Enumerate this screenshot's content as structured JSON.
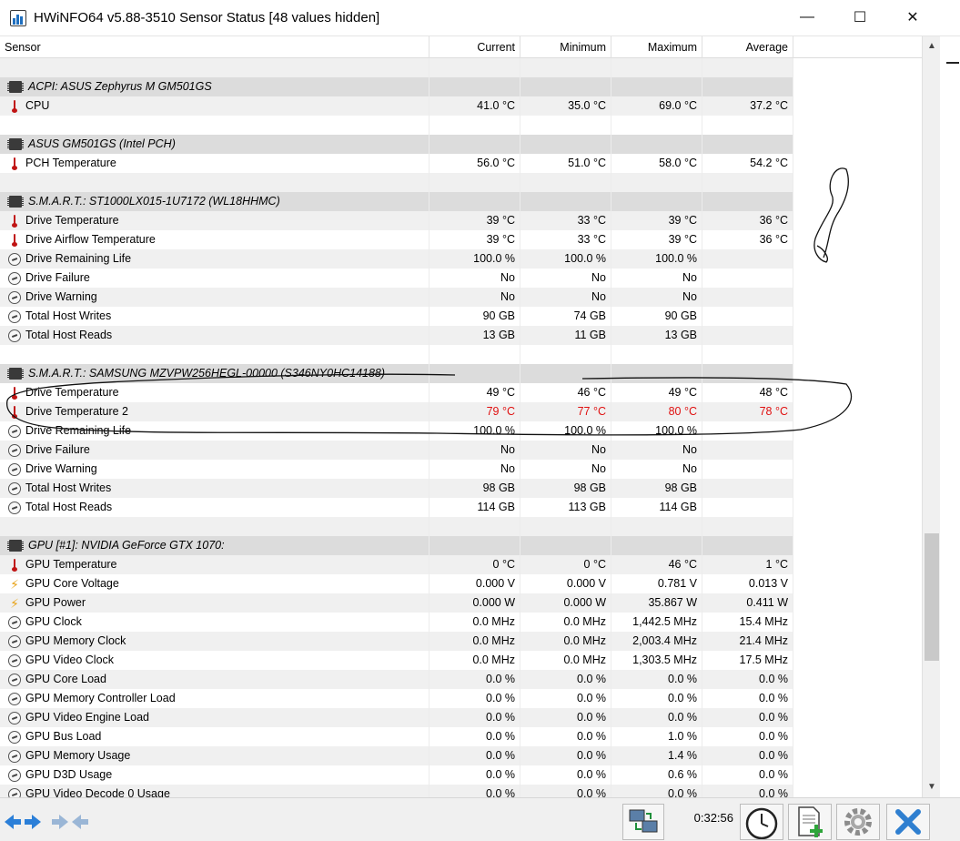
{
  "window": {
    "title": "HWiNFO64 v5.88-3510 Sensor Status [48 values hidden]",
    "minimize_glyph": "—",
    "maximize_glyph": "☐",
    "close_glyph": "✕"
  },
  "columns": {
    "sensor": "Sensor",
    "current": "Current",
    "minimum": "Minimum",
    "maximum": "Maximum",
    "average": "Average"
  },
  "rows": [
    {
      "type": "blank"
    },
    {
      "type": "group",
      "icon": "chip-icon",
      "label": "ACPI: ASUS Zephyrus M GM501GS"
    },
    {
      "type": "data",
      "icon": "thermometer-icon",
      "label": "CPU",
      "cur": "41.0 °C",
      "min": "35.0 °C",
      "max": "69.0 °C",
      "avg": "37.2 °C"
    },
    {
      "type": "blank"
    },
    {
      "type": "group",
      "icon": "chip-icon",
      "label": "ASUS GM501GS (Intel PCH)"
    },
    {
      "type": "data",
      "icon": "thermometer-icon",
      "label": "PCH Temperature",
      "cur": "56.0 °C",
      "min": "51.0 °C",
      "max": "58.0 °C",
      "avg": "54.2 °C"
    },
    {
      "type": "blank"
    },
    {
      "type": "group",
      "icon": "chip-icon",
      "label": "S.M.A.R.T.: ST1000LX015-1U7172 (WL18HHMC)"
    },
    {
      "type": "data",
      "icon": "thermometer-icon",
      "label": "Drive Temperature",
      "cur": "39 °C",
      "min": "33 °C",
      "max": "39 °C",
      "avg": "36 °C"
    },
    {
      "type": "data",
      "icon": "thermometer-icon",
      "label": "Drive Airflow Temperature",
      "cur": "39 °C",
      "min": "33 °C",
      "max": "39 °C",
      "avg": "36 °C"
    },
    {
      "type": "data",
      "icon": "gauge-icon",
      "label": "Drive Remaining Life",
      "cur": "100.0 %",
      "min": "100.0 %",
      "max": "100.0 %",
      "avg": ""
    },
    {
      "type": "data",
      "icon": "gauge-icon",
      "label": "Drive Failure",
      "cur": "No",
      "min": "No",
      "max": "No",
      "avg": ""
    },
    {
      "type": "data",
      "icon": "gauge-icon",
      "label": "Drive Warning",
      "cur": "No",
      "min": "No",
      "max": "No",
      "avg": ""
    },
    {
      "type": "data",
      "icon": "gauge-icon",
      "label": "Total Host Writes",
      "cur": "90 GB",
      "min": "74 GB",
      "max": "90 GB",
      "avg": ""
    },
    {
      "type": "data",
      "icon": "gauge-icon",
      "label": "Total Host Reads",
      "cur": "13 GB",
      "min": "11 GB",
      "max": "13 GB",
      "avg": ""
    },
    {
      "type": "blank"
    },
    {
      "type": "group",
      "icon": "chip-icon",
      "label": "S.M.A.R.T.: SAMSUNG MZVPW256HEGL-00000 (S346NY0HC14188)"
    },
    {
      "type": "data",
      "icon": "thermometer-icon",
      "label": "Drive Temperature",
      "cur": "49 °C",
      "min": "46 °C",
      "max": "49 °C",
      "avg": "48 °C"
    },
    {
      "type": "data",
      "icon": "thermometer-icon",
      "label": "Drive Temperature 2",
      "cur": "79 °C",
      "min": "77 °C",
      "max": "80 °C",
      "avg": "78 °C",
      "hot": true
    },
    {
      "type": "data",
      "icon": "gauge-icon",
      "label": "Drive Remaining Life",
      "cur": "100.0 %",
      "min": "100.0 %",
      "max": "100.0 %",
      "avg": ""
    },
    {
      "type": "data",
      "icon": "gauge-icon",
      "label": "Drive Failure",
      "cur": "No",
      "min": "No",
      "max": "No",
      "avg": ""
    },
    {
      "type": "data",
      "icon": "gauge-icon",
      "label": "Drive Warning",
      "cur": "No",
      "min": "No",
      "max": "No",
      "avg": ""
    },
    {
      "type": "data",
      "icon": "gauge-icon",
      "label": "Total Host Writes",
      "cur": "98 GB",
      "min": "98 GB",
      "max": "98 GB",
      "avg": ""
    },
    {
      "type": "data",
      "icon": "gauge-icon",
      "label": "Total Host Reads",
      "cur": "114 GB",
      "min": "113 GB",
      "max": "114 GB",
      "avg": ""
    },
    {
      "type": "blank"
    },
    {
      "type": "group",
      "icon": "chip-icon",
      "label": "GPU [#1]: NVIDIA GeForce GTX 1070:"
    },
    {
      "type": "data",
      "icon": "thermometer-icon",
      "label": "GPU Temperature",
      "cur": "0 °C",
      "min": "0 °C",
      "max": "46 °C",
      "avg": "1 °C"
    },
    {
      "type": "data",
      "icon": "lightning-icon",
      "label": "GPU Core Voltage",
      "cur": "0.000 V",
      "min": "0.000 V",
      "max": "0.781 V",
      "avg": "0.013 V"
    },
    {
      "type": "data",
      "icon": "lightning-icon",
      "label": "GPU Power",
      "cur": "0.000 W",
      "min": "0.000 W",
      "max": "35.867 W",
      "avg": "0.411 W"
    },
    {
      "type": "data",
      "icon": "gauge-icon",
      "label": "GPU Clock",
      "cur": "0.0 MHz",
      "min": "0.0 MHz",
      "max": "1,442.5 MHz",
      "avg": "15.4 MHz"
    },
    {
      "type": "data",
      "icon": "gauge-icon",
      "label": "GPU Memory Clock",
      "cur": "0.0 MHz",
      "min": "0.0 MHz",
      "max": "2,003.4 MHz",
      "avg": "21.4 MHz"
    },
    {
      "type": "data",
      "icon": "gauge-icon",
      "label": "GPU Video Clock",
      "cur": "0.0 MHz",
      "min": "0.0 MHz",
      "max": "1,303.5 MHz",
      "avg": "17.5 MHz"
    },
    {
      "type": "data",
      "icon": "gauge-icon",
      "label": "GPU Core Load",
      "cur": "0.0 %",
      "min": "0.0 %",
      "max": "0.0 %",
      "avg": "0.0 %"
    },
    {
      "type": "data",
      "icon": "gauge-icon",
      "label": "GPU Memory Controller Load",
      "cur": "0.0 %",
      "min": "0.0 %",
      "max": "0.0 %",
      "avg": "0.0 %"
    },
    {
      "type": "data",
      "icon": "gauge-icon",
      "label": "GPU Video Engine Load",
      "cur": "0.0 %",
      "min": "0.0 %",
      "max": "0.0 %",
      "avg": "0.0 %"
    },
    {
      "type": "data",
      "icon": "gauge-icon",
      "label": "GPU Bus Load",
      "cur": "0.0 %",
      "min": "0.0 %",
      "max": "1.0 %",
      "avg": "0.0 %"
    },
    {
      "type": "data",
      "icon": "gauge-icon",
      "label": "GPU Memory Usage",
      "cur": "0.0 %",
      "min": "0.0 %",
      "max": "1.4 %",
      "avg": "0.0 %"
    },
    {
      "type": "data",
      "icon": "gauge-icon",
      "label": "GPU D3D Usage",
      "cur": "0.0 %",
      "min": "0.0 %",
      "max": "0.6 %",
      "avg": "0.0 %"
    },
    {
      "type": "data",
      "icon": "gauge-icon",
      "label": "GPU Video Decode 0 Usage",
      "cur": "0.0 %",
      "min": "0.0 %",
      "max": "0.0 %",
      "avg": "0.0 %"
    }
  ],
  "toolbar": {
    "elapsed_time": "0:32:56"
  },
  "colors": {
    "hot_value": "#e01010",
    "group_row": "#dcdcdc",
    "alt_row": "#f0f0f0",
    "nav_arrow": "#2b7fd8"
  }
}
